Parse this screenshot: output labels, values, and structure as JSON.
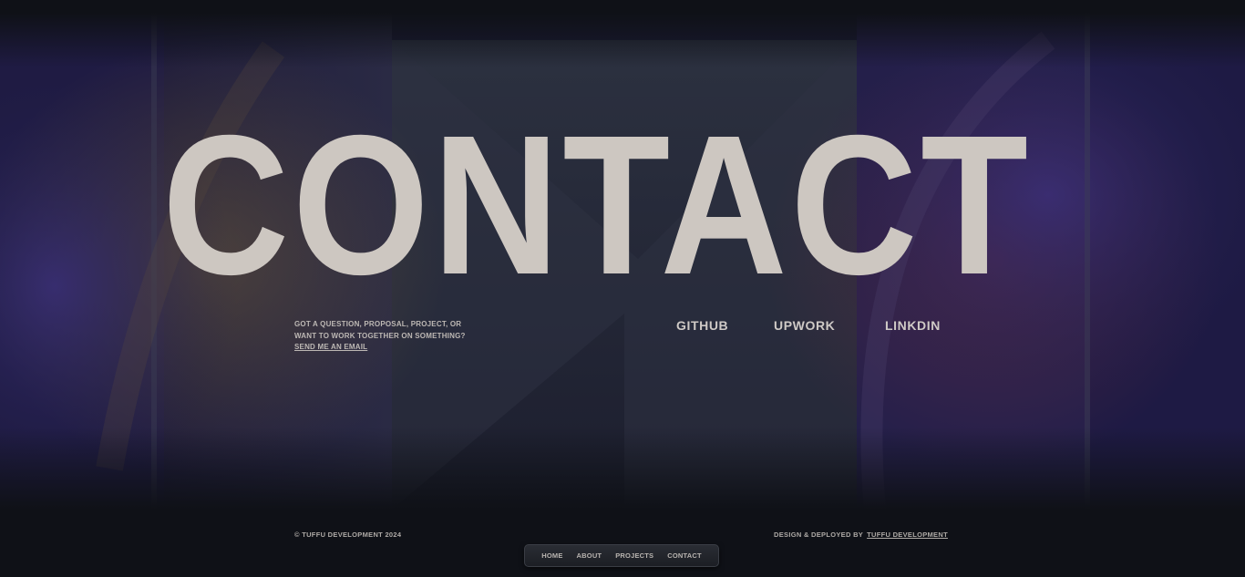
{
  "hero": {
    "title": "CONTACT"
  },
  "contact": {
    "line1": "GOT A QUESTION, PROPOSAL, PROJECT, OR",
    "line2": "WANT TO WORK TOGETHER ON SOMETHING?",
    "email_link": "SEND ME AN EMAIL"
  },
  "social": {
    "github": "GITHUB",
    "upwork": "UPWORK",
    "linkedin": "LINKDIN"
  },
  "footer": {
    "copyright": "© TUFFU DEVELOPMENT 2024",
    "credit_prefix": "DESIGN & DEPLOYED BY",
    "credit_link": "TUFFU DEVELOPMENT"
  },
  "nav": {
    "items": [
      "HOME",
      "ABOUT",
      "PROJECTS",
      "CONTACT"
    ]
  },
  "colors": {
    "background": "#0f1117",
    "title": "#cdc7c1",
    "text": "#bdb8b4"
  }
}
